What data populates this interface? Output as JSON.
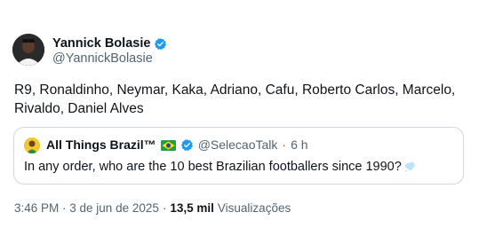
{
  "author": {
    "name": "Yannick Bolasie",
    "handle": "@YannickBolasie",
    "verified_color": "#1d9bf0"
  },
  "tweet": {
    "text": "R9, Ronaldinho, Neymar, Kaka, Adriano, Cafu, Roberto Carlos, Marcelo, Rivaldo, Daniel Alves"
  },
  "quoted": {
    "name": "All Things Brazil™",
    "flag_icon": "brazil-flag",
    "handle": "@SelecaoTalk",
    "separator": "·",
    "time": "6 h",
    "text": "In any order, who are the 10 best Brazilian footballers since 1990?",
    "trailing_icon": "thought-bubble"
  },
  "meta": {
    "timestamp": "3:46 PM · 3 de jun de 2025",
    "separator": "·",
    "views_count": "13,5 mil",
    "views_label": "Visualizações"
  },
  "colors": {
    "text_primary": "#0f1419",
    "text_secondary": "#536471",
    "border": "#cfd9de",
    "accent": "#1d9bf0"
  }
}
